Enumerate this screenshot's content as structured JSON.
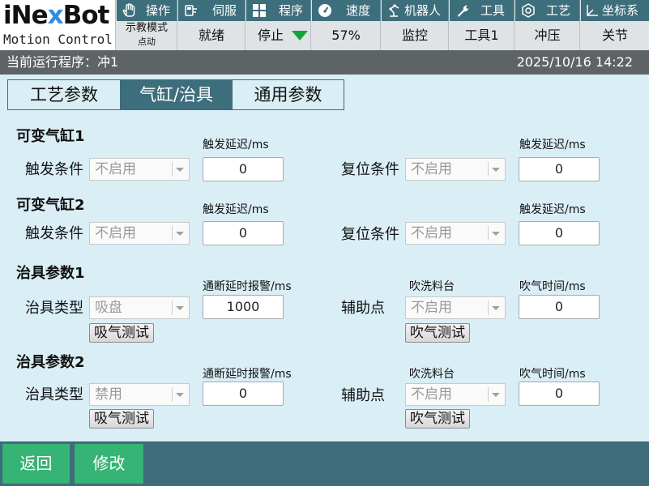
{
  "header": {
    "brand_prefix": "iNe",
    "brand_x": "x",
    "brand_suffix": "Bot",
    "slogan": "Motion Control",
    "tabs": [
      {
        "label": "操作",
        "icon": "hand-icon"
      },
      {
        "label": "伺服",
        "icon": "servo-icon"
      },
      {
        "label": "程序",
        "icon": "program-grid-icon"
      },
      {
        "label": "速度",
        "icon": "speedometer-icon"
      },
      {
        "label": "机器人",
        "icon": "robot-arm-icon"
      },
      {
        "label": "工具",
        "icon": "wrench-icon"
      },
      {
        "label": "工艺",
        "icon": "process-icon"
      },
      {
        "label": "坐标系",
        "icon": "coordinate-icon"
      }
    ],
    "status": {
      "mode_line1": "示教模式",
      "mode_line2": "点动",
      "ready": "就绪",
      "run_state": "停止",
      "speed": "57%",
      "monitor": "监控",
      "tool": "工具1",
      "process": "冲压",
      "coord": "关节"
    }
  },
  "program_bar": {
    "current_program": "当前运行程序：冲1",
    "datetime": "2025/10/16 14:22"
  },
  "subtabs": [
    "工艺参数",
    "气缸/治具",
    "通用参数"
  ],
  "active_subtab": 1,
  "sections": {
    "cyl1": {
      "title": "可变气缸1",
      "trigger_label": "触发条件",
      "trigger_value": "不启用",
      "delay_label": "触发延迟/ms",
      "delay_value": "0",
      "reset_label": "复位条件",
      "reset_value": "不启用",
      "reset_delay_label": "触发延迟/ms",
      "reset_delay_value": "0"
    },
    "cyl2": {
      "title": "可变气缸2",
      "trigger_label": "触发条件",
      "trigger_value": "不启用",
      "delay_label": "触发延迟/ms",
      "delay_value": "0",
      "reset_label": "复位条件",
      "reset_value": "不启用",
      "reset_delay_label": "触发延迟/ms",
      "reset_delay_value": "0"
    },
    "fix1": {
      "title": "治具参数1",
      "type_label": "治具类型",
      "type_value": "吸盘",
      "alarm_label": "通断延时报警/ms",
      "alarm_value": "1000",
      "blow_test": "吸气测试",
      "aux_label": "辅助点",
      "blow_table_label": "吹洗料台",
      "blow_table_value": "不启用",
      "blow_time_label": "吹气时间/ms",
      "blow_time_value": "0",
      "blow_test2": "吹气测试"
    },
    "fix2": {
      "title": "治具参数2",
      "type_label": "治具类型",
      "type_value": "禁用",
      "alarm_label": "通断延时报警/ms",
      "alarm_value": "0",
      "blow_test": "吸气测试",
      "aux_label": "辅助点",
      "blow_table_label": "吹洗料台",
      "blow_table_value": "不启用",
      "blow_time_label": "吹气时间/ms",
      "blow_time_value": "0",
      "blow_test2": "吹气测试"
    }
  },
  "footer": {
    "back": "返回",
    "edit": "修改"
  },
  "colors": {
    "accent": "#3d6e7b",
    "footer_button": "#36b475",
    "run_indicator": "#14a33a",
    "page_bg": "#daeef6",
    "brand_x": "#2e8fe0"
  }
}
